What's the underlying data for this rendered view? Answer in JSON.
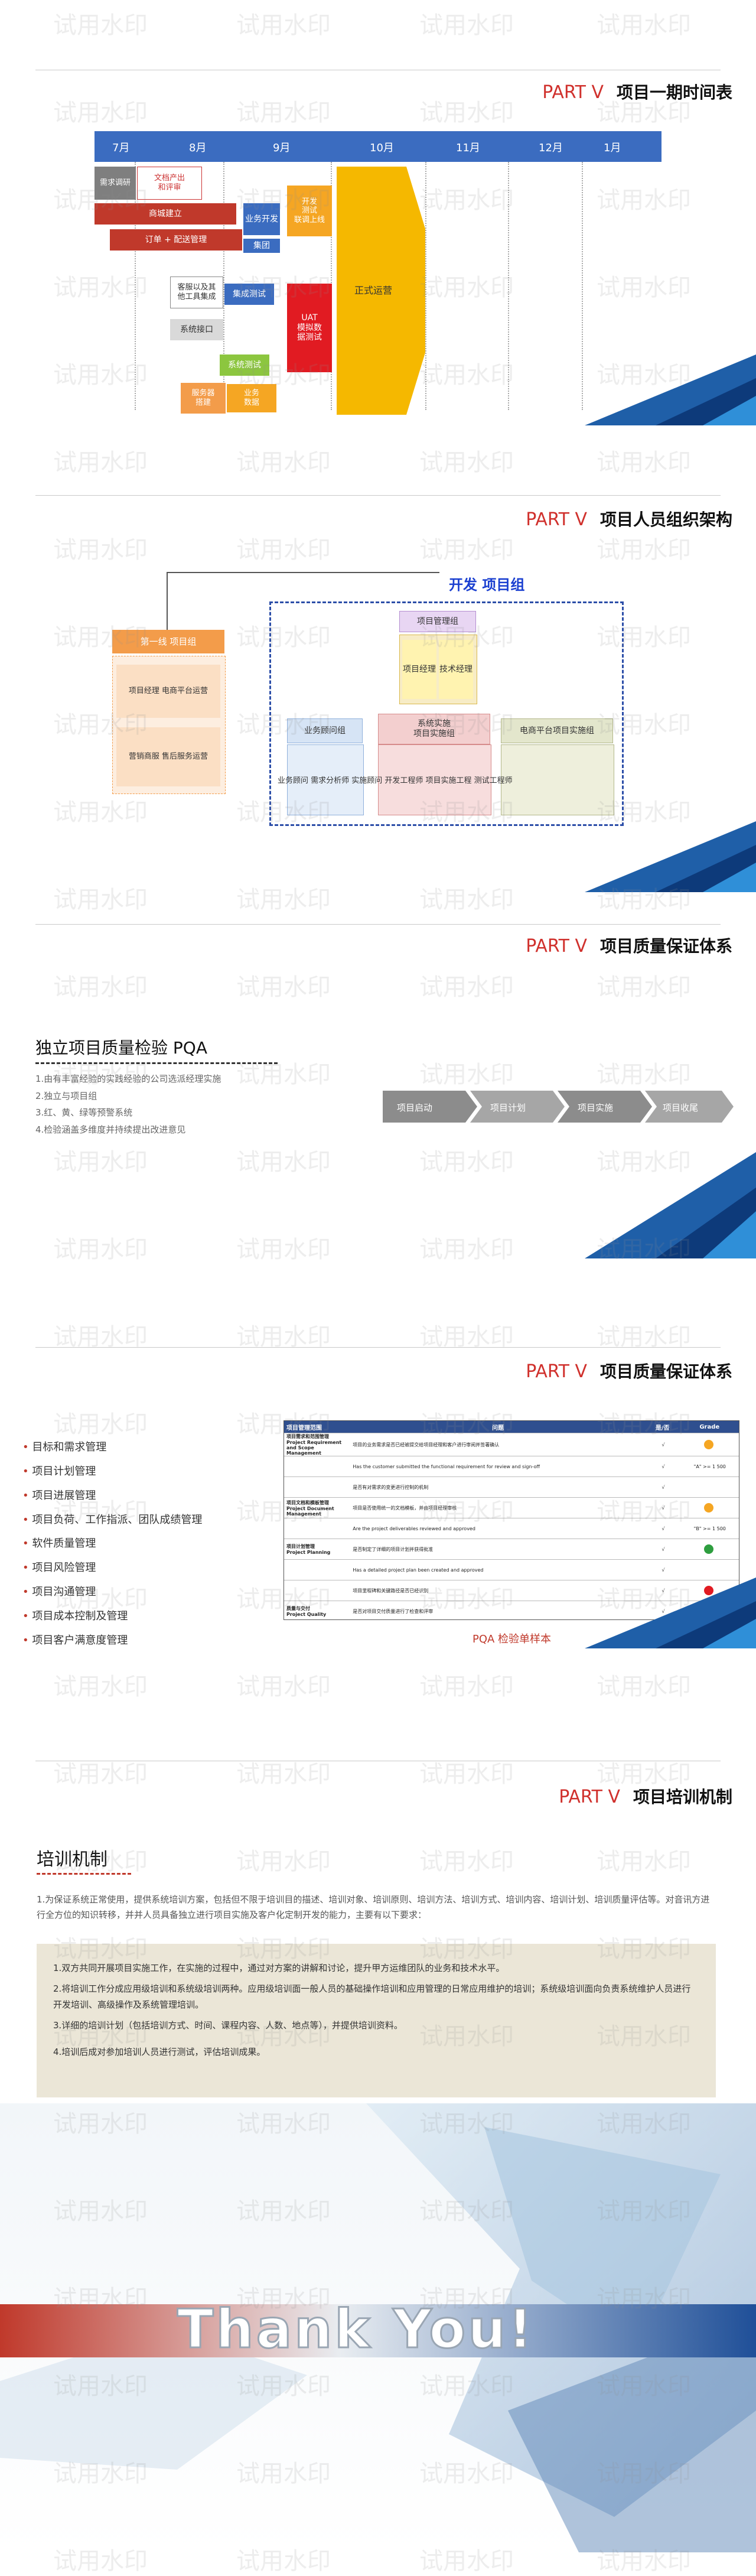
{
  "watermark_text": "试用水印",
  "slide1": {
    "part": "PART Ⅴ",
    "title": "项目一期时间表",
    "months": [
      "7月",
      "8月",
      "9月",
      "10月",
      "11月",
      "12月",
      "1月"
    ],
    "tasks": [
      {
        "label": "需求调研"
      },
      {
        "label": "文档产出\n和评审"
      },
      {
        "label": "商城建立"
      },
      {
        "label": "业务开发"
      },
      {
        "label": "订单 + 配送管理"
      },
      {
        "label": "集团"
      },
      {
        "label": "开发\n测试\n联调上线"
      },
      {
        "label": "客服以及其\n他工具集成"
      },
      {
        "label": "集成测试"
      },
      {
        "label": "系统接口"
      },
      {
        "label": "系统测试"
      },
      {
        "label": "服务器\n搭建"
      },
      {
        "label": "业务\n数据"
      },
      {
        "label": "UAT\n模拟数\n据测试"
      },
      {
        "label": "正式运营"
      }
    ]
  },
  "slide2": {
    "part": "PART Ⅴ",
    "title": "项目人员组织架构",
    "dev_group": "开发 项目组",
    "left_top": "第一线 项目组",
    "left_mid": "项目经理 电商平台运营",
    "left_bot": "营销商服 售后服务运营",
    "pm": "项目管理组",
    "pm_sub1": "项目经理",
    "pm_sub2": "技术经理",
    "biz": "业务顾问组",
    "impl": "系统实施\n项目实施组",
    "ecom": "电商平台项目实施组",
    "bottom_text": "业务顾问 需求分析师   实施顾问 开发工程师   项目实施工程 测试工程师"
  },
  "slide3": {
    "part": "PART Ⅴ",
    "title": "项目质量保证体系",
    "heading": "独立项目质量检验 PQA",
    "items": [
      "1.由有丰富经验的实践经验的公司选派经理实施",
      "2.独立与项目组",
      "3.红、黄、绿等预警系统",
      "4.检验涵盖多维度并持续提出改进意见"
    ],
    "flow": [
      "项目启动",
      "项目计划",
      "项目实施",
      "项目收尾"
    ]
  },
  "slide4": {
    "part": "PART Ⅴ",
    "title": "项目质量保证体系",
    "items": [
      "目标和需求管理",
      "项目计划管理",
      "项目进展管理",
      "项目负荷、工作指派、团队成绩管理",
      "软件质量管理",
      "项目风险管理",
      "项目沟通管理",
      "项目成本控制及管理",
      "项目客户满意度管理"
    ],
    "table_headers": [
      "项目管理范围",
      "问题",
      "是/否",
      "Grade"
    ],
    "table_rows": [
      {
        "area": "项目需求和范围管理\nProject Requirement and Scope Management",
        "q": "项目的业务需求是否已经被提交给项目经理和客户进行审阅并签署确认",
        "yn": "√",
        "grade": "orange",
        "score": ""
      },
      {
        "area": "",
        "q": "Has the customer submitted the functional requirement for review and sign-off",
        "yn": "√",
        "grade": "",
        "score": "\"A\" >= 1 500"
      },
      {
        "area": "",
        "q": "是否有对需求的变更进行控制的机制",
        "yn": "√",
        "grade": "",
        "score": ""
      },
      {
        "area": "项目文档和模板管理\nProject Document Management",
        "q": "项目是否使用统一的文档模板，并由项目经理审核",
        "yn": "√",
        "grade": "orange",
        "score": ""
      },
      {
        "area": "",
        "q": "Are the project deliverables reviewed and approved",
        "yn": "√",
        "grade": "",
        "score": "\"B\" >= 1 500"
      },
      {
        "area": "项目计划管理\nProject Planning",
        "q": "是否制定了详细的项目计划并获得批准",
        "yn": "√",
        "grade": "green",
        "score": ""
      },
      {
        "area": "",
        "q": "Has a detailed project plan been created and approved",
        "yn": "√",
        "grade": "",
        "score": ""
      },
      {
        "area": "",
        "q": "项目里程碑和关键路径是否已经识别",
        "yn": "√",
        "grade": "red",
        "score": ""
      },
      {
        "area": "质量与交付\nProject Quality",
        "q": "是否对项目交付质量进行了检查和评审",
        "yn": "√",
        "grade": "",
        "score": "\"C\" >= 1 500"
      }
    ],
    "caption": "PQA 检验单样本"
  },
  "slide5": {
    "part": "PART Ⅴ",
    "title": "项目培训机制",
    "heading": "培训机制",
    "intro": "1.为保证系统正常使用，提供系统培训方案，包括但不限于培训目的描述、培训对象、培训原则、培训方法、培训方式、培训内容、培训计划、培训质量评估等。对音讯方进行全方位的知识转移，并并人员具备独立进行项目实施及客户化定制开发的能力，主要有以下要求：",
    "points": [
      "1.双方共同开展项目实施工作，在实施的过程中，通过对方案的讲解和讨论，提升甲方运维团队的业务和技术水平。",
      "2.将培训工作分成应用级培训和系统级培训两种。应用级培训面一般人员的基础操作培训和应用管理的日常应用维护的培训；系统级培训面向负责系统维护人员进行开发培训、高级操作及系统管理培训。",
      "3.详细的培训计划（包括培训方式、时间、课程内容、人数、地点等），并提供培训资料。",
      "4.培训后成对参加培训人员进行测试，评估培训成果。"
    ]
  },
  "slide6": {
    "thanks": "Thank You!"
  }
}
